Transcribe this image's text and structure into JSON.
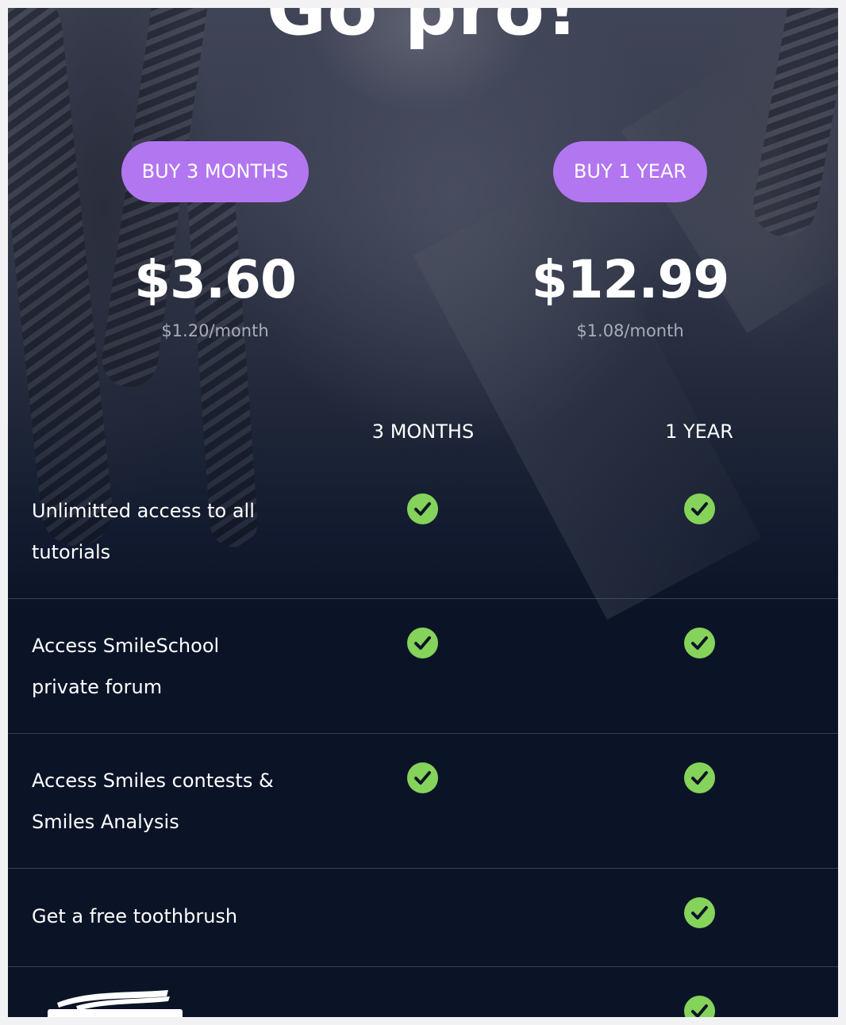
{
  "header": {
    "title": "Go pro!"
  },
  "plans": [
    {
      "button_label": "BUY 3 MONTHS",
      "price": "$3.60",
      "per_month": "$1.20/month"
    },
    {
      "button_label": "BUY 1 YEAR",
      "price": "$12.99",
      "per_month": "$1.08/month"
    }
  ],
  "table": {
    "columns": [
      "3 MONTHS",
      "1 YEAR"
    ],
    "rows": [
      {
        "feature": "Unlimitted access to all tutorials",
        "three_months": true,
        "one_year": true
      },
      {
        "feature": "Access SmileSchool private forum",
        "three_months": true,
        "one_year": true
      },
      {
        "feature": "Access Smiles contests & Smiles Analysis",
        "three_months": true,
        "one_year": true
      },
      {
        "feature": "Get a free toothbrush",
        "three_months": false,
        "one_year": true
      },
      {
        "feature": "",
        "logo": "signal-logo",
        "three_months": false,
        "one_year": true
      }
    ]
  },
  "colors": {
    "button": "#b276f0",
    "check": "#85d35a",
    "background": "#0b1427",
    "muted_text": "#a9adb9"
  },
  "icons": {
    "check": "check-circle-icon",
    "logo": "signal-logo"
  }
}
